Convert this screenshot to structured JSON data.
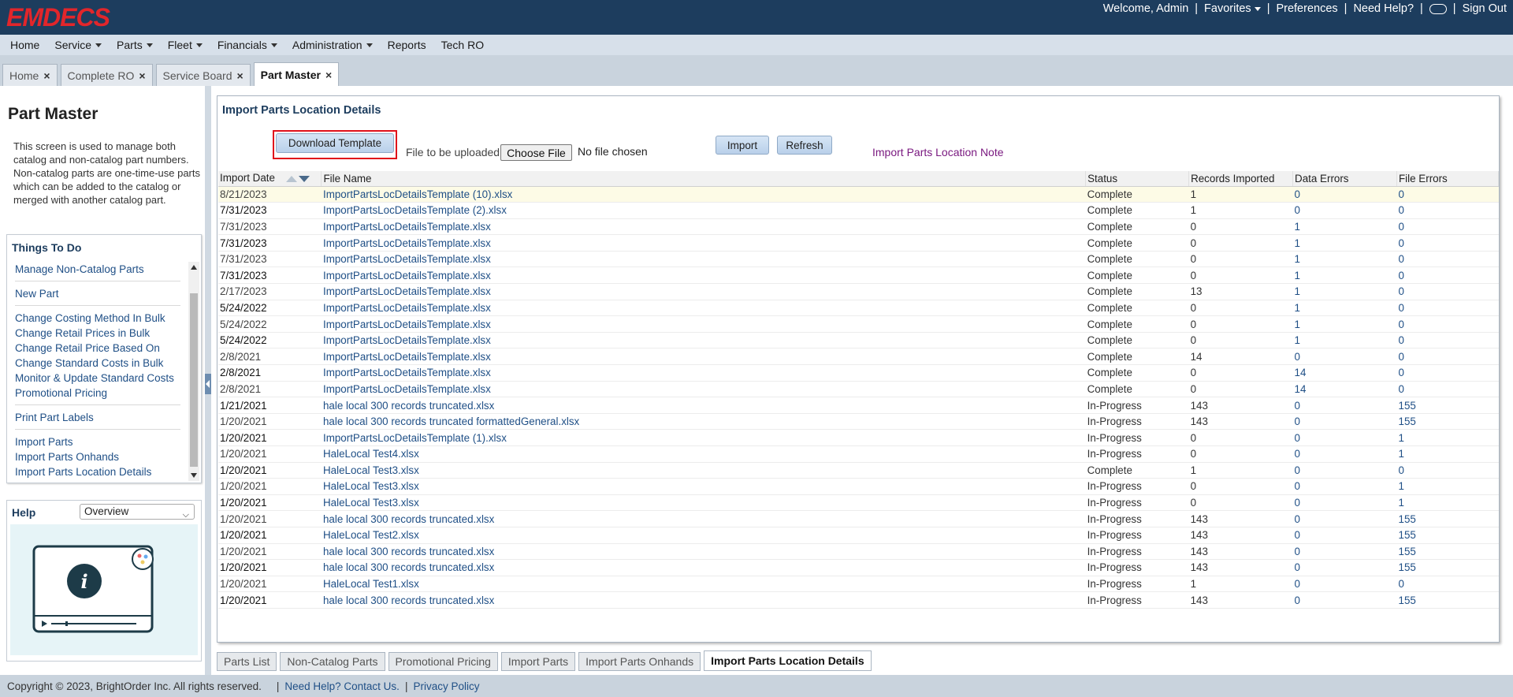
{
  "app": {
    "logo": "EMDECS"
  },
  "header": {
    "welcome": "Welcome, Admin",
    "favorites": "Favorites",
    "preferences": "Preferences",
    "need_help": "Need Help?",
    "toggle_icon": "toggle-icon",
    "sign_out": "Sign Out"
  },
  "menu": [
    {
      "label": "Home",
      "dropdown": false
    },
    {
      "label": "Service",
      "dropdown": true
    },
    {
      "label": "Parts",
      "dropdown": true
    },
    {
      "label": "Fleet",
      "dropdown": true
    },
    {
      "label": "Financials",
      "dropdown": true
    },
    {
      "label": "Administration",
      "dropdown": true
    },
    {
      "label": "Reports",
      "dropdown": false
    },
    {
      "label": "Tech RO",
      "dropdown": false
    }
  ],
  "top_tabs": [
    {
      "label": "Home",
      "active": false
    },
    {
      "label": "Complete RO",
      "active": false
    },
    {
      "label": "Service Board",
      "active": false
    },
    {
      "label": "Part Master",
      "active": true
    }
  ],
  "left": {
    "title": "Part Master",
    "description": "This screen is used to manage both catalog and non-catalog part numbers. Non-catalog parts are one-time-use parts which can be added to the catalog or merged with another catalog part.",
    "things_to_do": {
      "title": "Things To Do",
      "groups": [
        [
          "Manage Non-Catalog Parts"
        ],
        [
          "New Part"
        ],
        [
          "Change Costing Method In Bulk",
          "Change Retail Prices in Bulk",
          "Change Retail Price Based On",
          "Change Standard Costs in Bulk",
          "Monitor & Update Standard Costs",
          "Promotional Pricing"
        ],
        [
          "Print Part Labels"
        ],
        [
          "Import Parts",
          "Import Parts Onhands",
          "Import Parts Location Details"
        ]
      ]
    },
    "help": {
      "title": "Help",
      "selected": "Overview"
    }
  },
  "main": {
    "title": "Import Parts Location Details",
    "download_template": "Download Template",
    "file_label": "File to be uploaded",
    "choose_file": "Choose File",
    "no_file": "No file chosen",
    "import": "Import",
    "refresh": "Refresh",
    "note_link": "Import Parts Location Note",
    "columns": [
      "Import Date",
      "File Name",
      "Status",
      "Records Imported",
      "Data Errors",
      "File Errors"
    ],
    "rows": [
      [
        "8/21/2023",
        "ImportPartsLocDetailsTemplate (10).xlsx",
        "Complete",
        "1",
        "0",
        "0"
      ],
      [
        "7/31/2023",
        "ImportPartsLocDetailsTemplate (2).xlsx",
        "Complete",
        "1",
        "0",
        "0"
      ],
      [
        "7/31/2023",
        "ImportPartsLocDetailsTemplate.xlsx",
        "Complete",
        "0",
        "1",
        "0"
      ],
      [
        "7/31/2023",
        "ImportPartsLocDetailsTemplate.xlsx",
        "Complete",
        "0",
        "1",
        "0"
      ],
      [
        "7/31/2023",
        "ImportPartsLocDetailsTemplate.xlsx",
        "Complete",
        "0",
        "1",
        "0"
      ],
      [
        "7/31/2023",
        "ImportPartsLocDetailsTemplate.xlsx",
        "Complete",
        "0",
        "1",
        "0"
      ],
      [
        "2/17/2023",
        "ImportPartsLocDetailsTemplate.xlsx",
        "Complete",
        "13",
        "1",
        "0"
      ],
      [
        "5/24/2022",
        "ImportPartsLocDetailsTemplate.xlsx",
        "Complete",
        "0",
        "1",
        "0"
      ],
      [
        "5/24/2022",
        "ImportPartsLocDetailsTemplate.xlsx",
        "Complete",
        "0",
        "1",
        "0"
      ],
      [
        "5/24/2022",
        "ImportPartsLocDetailsTemplate.xlsx",
        "Complete",
        "0",
        "1",
        "0"
      ],
      [
        "2/8/2021",
        "ImportPartsLocDetailsTemplate.xlsx",
        "Complete",
        "14",
        "0",
        "0"
      ],
      [
        "2/8/2021",
        "ImportPartsLocDetailsTemplate.xlsx",
        "Complete",
        "0",
        "14",
        "0"
      ],
      [
        "2/8/2021",
        "ImportPartsLocDetailsTemplate.xlsx",
        "Complete",
        "0",
        "14",
        "0"
      ],
      [
        "1/21/2021",
        "hale local 300 records truncated.xlsx",
        "In-Progress",
        "143",
        "0",
        "155"
      ],
      [
        "1/20/2021",
        "hale local 300 records truncated formattedGeneral.xlsx",
        "In-Progress",
        "143",
        "0",
        "155"
      ],
      [
        "1/20/2021",
        "ImportPartsLocDetailsTemplate (1).xlsx",
        "In-Progress",
        "0",
        "0",
        "1"
      ],
      [
        "1/20/2021",
        "HaleLocal Test4.xlsx",
        "In-Progress",
        "0",
        "0",
        "1"
      ],
      [
        "1/20/2021",
        "HaleLocal Test3.xlsx",
        "Complete",
        "1",
        "0",
        "0"
      ],
      [
        "1/20/2021",
        "HaleLocal Test3.xlsx",
        "In-Progress",
        "0",
        "0",
        "1"
      ],
      [
        "1/20/2021",
        "HaleLocal Test3.xlsx",
        "In-Progress",
        "0",
        "0",
        "1"
      ],
      [
        "1/20/2021",
        "hale local 300 records truncated.xlsx",
        "In-Progress",
        "143",
        "0",
        "155"
      ],
      [
        "1/20/2021",
        "HaleLocal Test2.xlsx",
        "In-Progress",
        "143",
        "0",
        "155"
      ],
      [
        "1/20/2021",
        "hale local 300 records truncated.xlsx",
        "In-Progress",
        "143",
        "0",
        "155"
      ],
      [
        "1/20/2021",
        "hale local 300 records truncated.xlsx",
        "In-Progress",
        "143",
        "0",
        "155"
      ],
      [
        "1/20/2021",
        "HaleLocal Test1.xlsx",
        "In-Progress",
        "1",
        "0",
        "0"
      ],
      [
        "1/20/2021",
        "hale local 300 records truncated.xlsx",
        "In-Progress",
        "143",
        "0",
        "155"
      ]
    ]
  },
  "bottom_tabs": [
    {
      "label": "Parts List",
      "active": false
    },
    {
      "label": "Non-Catalog Parts",
      "active": false
    },
    {
      "label": "Promotional Pricing",
      "active": false
    },
    {
      "label": "Import Parts",
      "active": false
    },
    {
      "label": "Import Parts Onhands",
      "active": false
    },
    {
      "label": "Import Parts Location Details",
      "active": true
    }
  ],
  "footer": {
    "copyright": "Copyright © 2023, BrightOrder Inc. All rights reserved.",
    "contact": "Need Help? Contact Us.",
    "privacy": "Privacy Policy"
  },
  "colors": {
    "header_bg": "#1d3d5e",
    "logo": "#e2262b",
    "link": "#1f4f86",
    "highlight_box": "#e0111b",
    "note_link": "#7a1a80"
  }
}
